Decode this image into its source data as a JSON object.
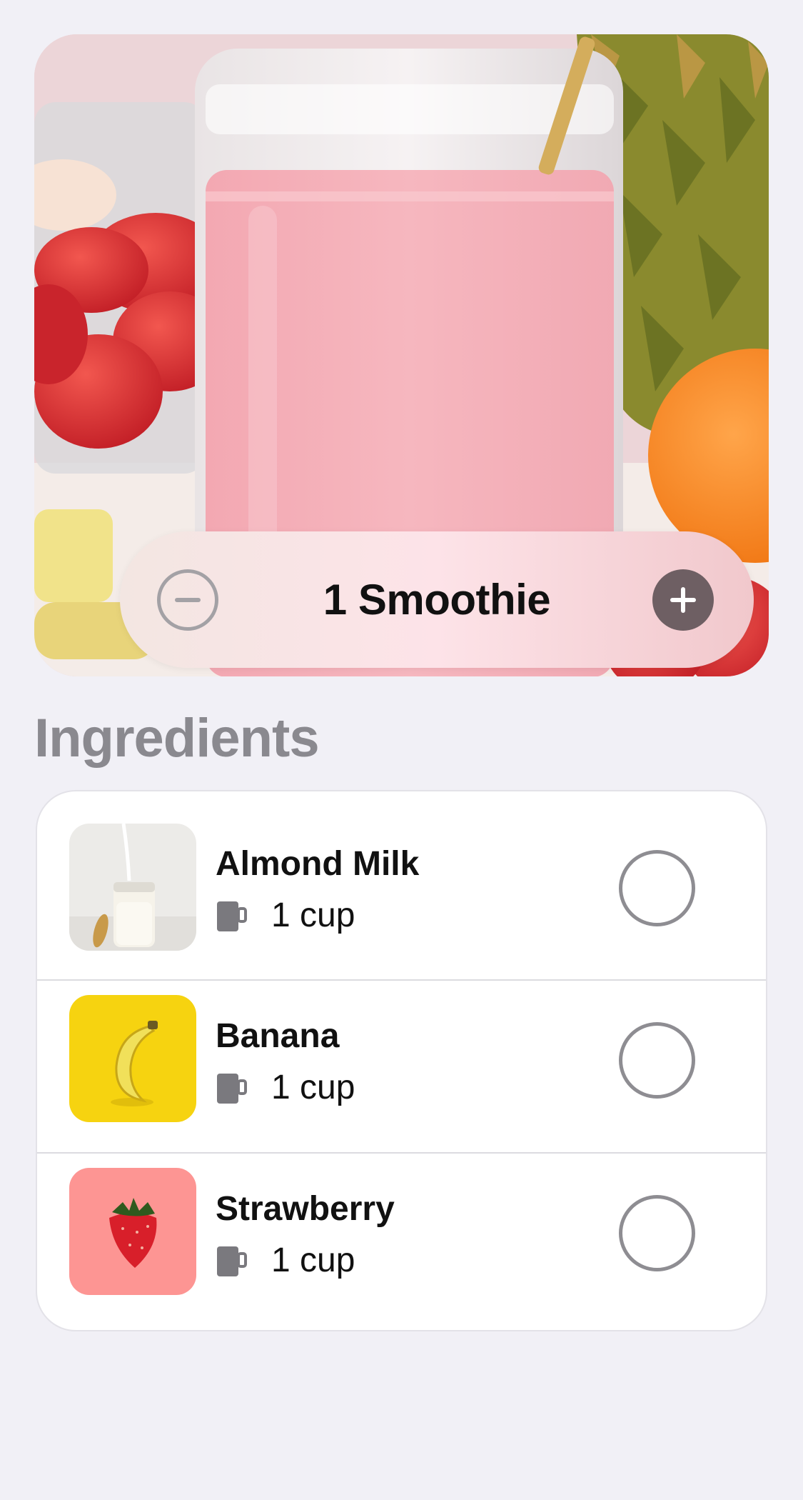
{
  "hero": {
    "image": "strawberry-smoothie-photo",
    "stepper": {
      "value_label": "1 Smoothie",
      "decrement_icon": "minus-circle-icon",
      "increment_icon": "plus-circle-icon"
    }
  },
  "section": {
    "title": "Ingredients"
  },
  "ingredients": [
    {
      "name": "Almond Milk",
      "amount": "1 cup",
      "icon": "cup-icon",
      "thumb": "almond-milk-jar-photo",
      "checked": false
    },
    {
      "name": "Banana",
      "amount": "1 cup",
      "icon": "cup-icon",
      "thumb": "banana-photo",
      "checked": false
    },
    {
      "name": "Strawberry",
      "amount": "1 cup",
      "icon": "cup-icon",
      "thumb": "strawberry-photo",
      "checked": false
    }
  ],
  "colors": {
    "background": "#f1f0f6",
    "heading": "#8a898f",
    "plus_button": "#6e5f63",
    "checkbox_border": "#8e8d92"
  }
}
